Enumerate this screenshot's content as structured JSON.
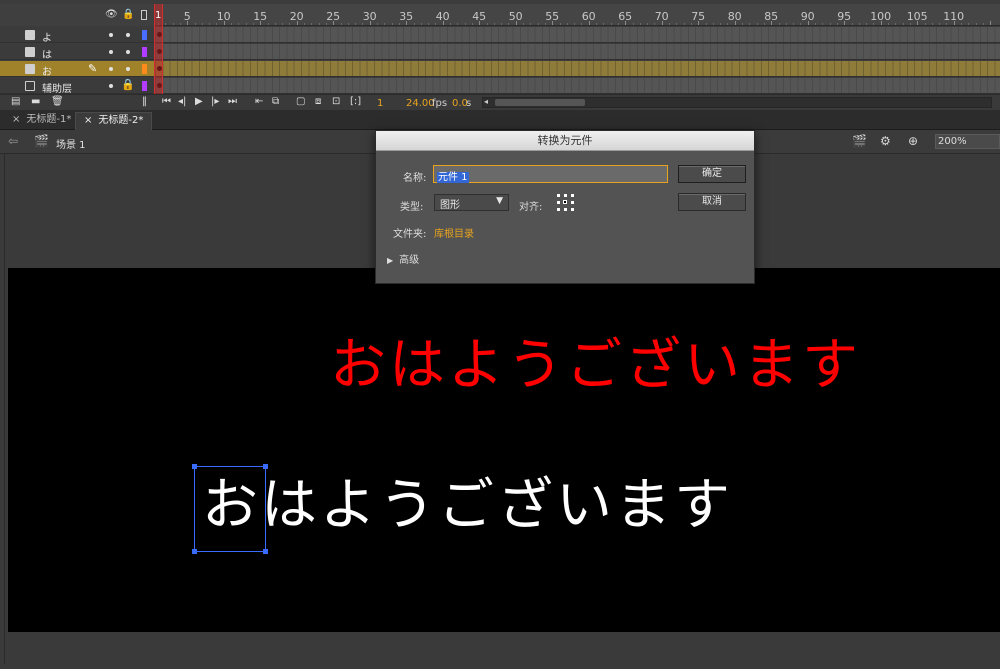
{
  "timeline": {
    "ruler_labels": [
      "1",
      "5",
      "10",
      "15",
      "20",
      "25",
      "30",
      "35",
      "40",
      "45",
      "50",
      "55",
      "60",
      "65",
      "70",
      "75",
      "80",
      "85",
      "90",
      "95",
      "100",
      "105",
      "110"
    ],
    "playhead_frame": "1",
    "header_icons": [
      "eye-icon",
      "lock-icon",
      "outline-icon"
    ],
    "layers": [
      {
        "name": "よ",
        "color": "#4a6cff",
        "active": false,
        "guide": false
      },
      {
        "name": "は",
        "color": "#b23cff",
        "active": false,
        "guide": false
      },
      {
        "name": "お",
        "color": "#ff8a1c",
        "active": true,
        "guide": false
      },
      {
        "name": "辅助层",
        "color": "#b23cff",
        "active": false,
        "guide": true
      }
    ],
    "footer": {
      "current_frame": "1",
      "frame_rate": "24.00",
      "frame_rate_unit": "fps",
      "elapsed_time": "0.0",
      "elapsed_unit": "s"
    }
  },
  "doc_tabs": [
    {
      "label": "无标题-1*",
      "active": false
    },
    {
      "label": "无标题-2*",
      "active": true
    }
  ],
  "edit_bar": {
    "scene": "场景 1",
    "zoom": "200%"
  },
  "stage": {
    "red_text": "おはようございます",
    "white_text": "おはようございます",
    "red_color": "#ff0000",
    "white_color": "#ffffff"
  },
  "dialog": {
    "title": "转换为元件",
    "name_label": "名称:",
    "name_value": "元件 1",
    "type_label": "类型:",
    "type_value": "图形",
    "align_label": "对齐:",
    "folder_label": "文件夹:",
    "folder_value": "库根目录",
    "advanced_label": "高级",
    "ok_button": "确定",
    "cancel_button": "取消"
  }
}
